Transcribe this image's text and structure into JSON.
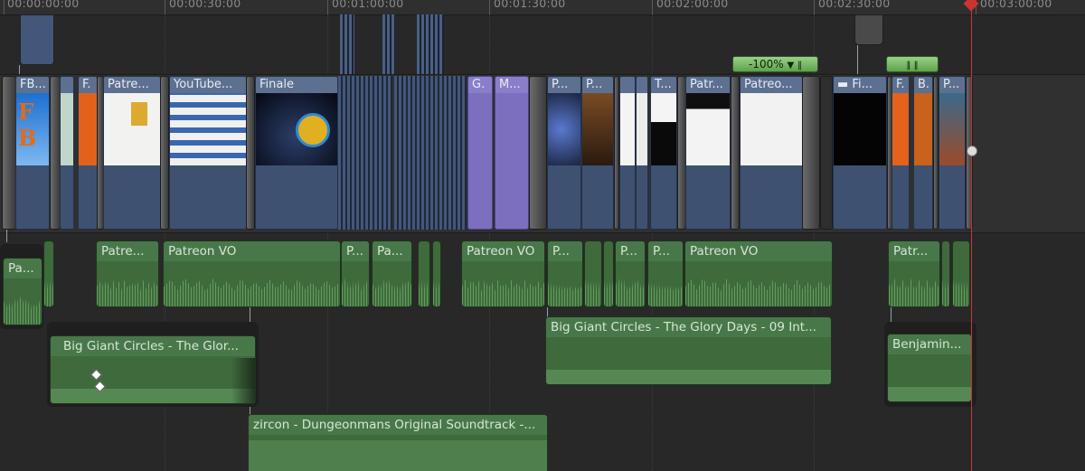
{
  "ruler": {
    "labels": [
      "00:00:00:00",
      "00:00:30:00",
      "00:01:00:00",
      "00:01:30:00",
      "00:02:00:00",
      "00:02:30:00",
      "00:03:00:00"
    ]
  },
  "retime": {
    "speed_label": "-100%",
    "dropdown_icon": "triangle-down-icon"
  },
  "video_clips": {
    "fb": "FB...",
    "f1": "F.",
    "patreon1": "Patre...",
    "youtube": "YouTube...",
    "finale": "Finale",
    "g": "G.",
    "m": "M...",
    "p1": "P...",
    "p2": "P...",
    "t": "T...",
    "patreon2": "Patr...",
    "patreon3": "Patreo...",
    "fi": "Fi...",
    "f2": "F.",
    "b": "B.",
    "p3": "P..."
  },
  "audio_clips": {
    "pa_left": "Pa...",
    "patreon_a1": "Patre...",
    "patreon_vo1": "Patreon VO",
    "p_a1": "P...",
    "pa_a2": "Pa...",
    "patreon_vo2": "Patreon VO",
    "p_a3": "P...",
    "p_a4": "P...",
    "p_a5": "P...",
    "patreon_vo3": "Patreon VO",
    "patr_a6": "Patr...",
    "big_giant_1": "Big Giant Circles - The Glor...",
    "big_giant_2": "Big Giant Circles - The Glory Days - 09 Int...",
    "benjamin": "Benjamin...",
    "zircon": "zircon - Dungeonmans Original Soundtrack -..."
  },
  "colors": {
    "video_clip": "#485c7c",
    "compound_clip": "#7c6fc0",
    "audio_clip": "#3e6a3c",
    "retime_bar": "#6fb45a",
    "playhead": "#cc3333"
  }
}
